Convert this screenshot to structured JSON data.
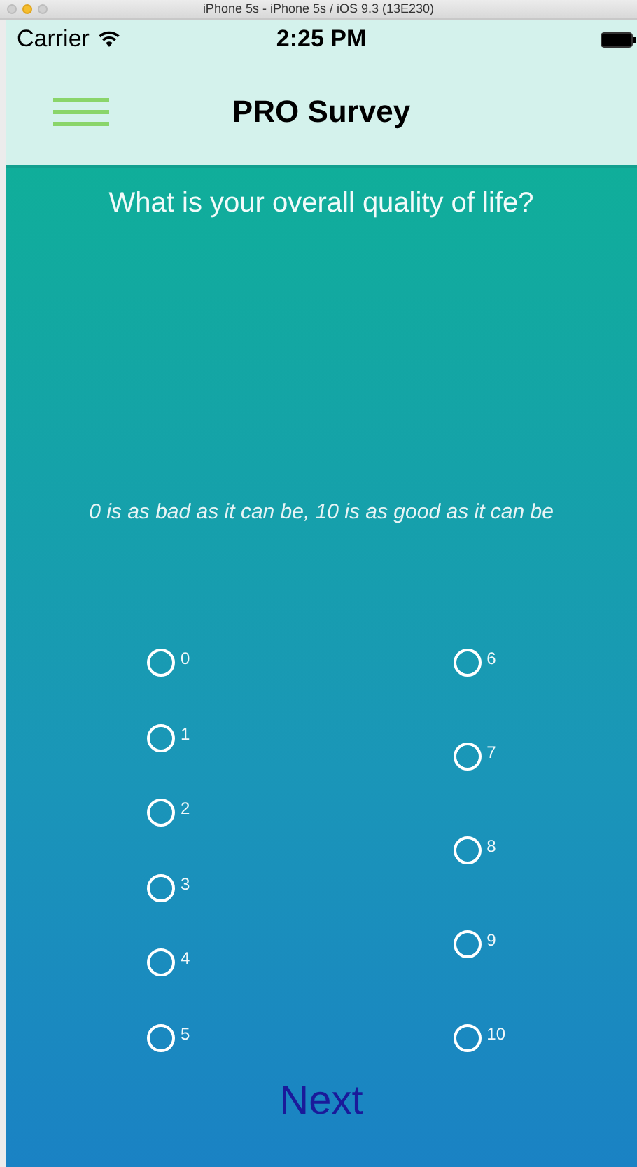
{
  "window": {
    "title": "iPhone 5s - iPhone 5s / iOS 9.3 (13E230)"
  },
  "status_bar": {
    "carrier": "Carrier",
    "time": "2:25 PM"
  },
  "nav_bar": {
    "title": "PRO Survey"
  },
  "question": "What is your overall quality of life?",
  "hint": "0 is as bad as it can be, 10 is as good as it can be",
  "option_columns": [
    [
      {
        "label": "0",
        "selected": false
      },
      {
        "label": "1",
        "selected": false
      },
      {
        "label": "2",
        "selected": false
      },
      {
        "label": "3",
        "selected": false
      },
      {
        "label": "4",
        "selected": false
      },
      {
        "label": "5",
        "selected": false
      }
    ],
    [
      {
        "label": "6",
        "selected": false
      },
      {
        "label": "7",
        "selected": false
      },
      {
        "label": "8",
        "selected": false
      },
      {
        "label": "9",
        "selected": false
      },
      {
        "label": "10",
        "selected": false
      }
    ]
  ],
  "next_button": "Next"
}
